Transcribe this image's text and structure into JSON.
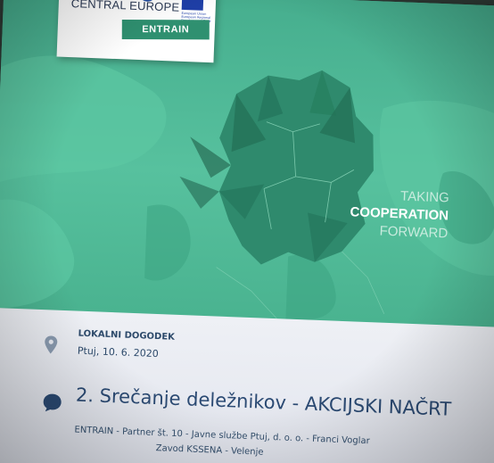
{
  "logo": {
    "brand": "reg",
    "program": "CENTRAL EUROPE",
    "eu_text": "European Union European Regional Development Fund",
    "project": "ENTRAIN"
  },
  "slogan": {
    "line1": "TAKING",
    "line2": "COOPERATION",
    "line3": "FORWARD"
  },
  "event": {
    "label": "LOKALNI DOGODEK",
    "date": "Ptuj, 10. 6. 2020"
  },
  "title": "2. Srečanje deležnikov - AKCIJSKI NAČRT",
  "subtitle": {
    "line1": "ENTRAIN - Partner št. 10 - Javne službe Ptuj, d. o. o. - Franci Voglar",
    "line2": "Zavod KSSENA - Velenje"
  },
  "colors": {
    "slide_green": "#4fb595",
    "map_dark": "#2f8a6d",
    "title_blue": "#2b4a73",
    "badge_green": "#2f9070"
  }
}
